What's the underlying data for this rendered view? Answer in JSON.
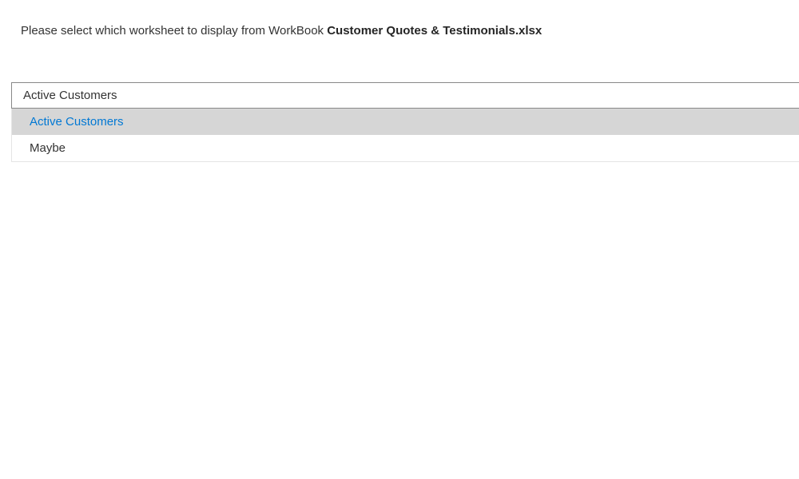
{
  "prompt": {
    "prefix": "Please select which worksheet to display from WorkBook ",
    "filename": "Customer Quotes & Testimonials.xlsx"
  },
  "dropdown": {
    "selected": "Active Customers",
    "options": [
      {
        "label": "Active Customers",
        "highlighted": true
      },
      {
        "label": "Maybe",
        "highlighted": false
      }
    ]
  }
}
